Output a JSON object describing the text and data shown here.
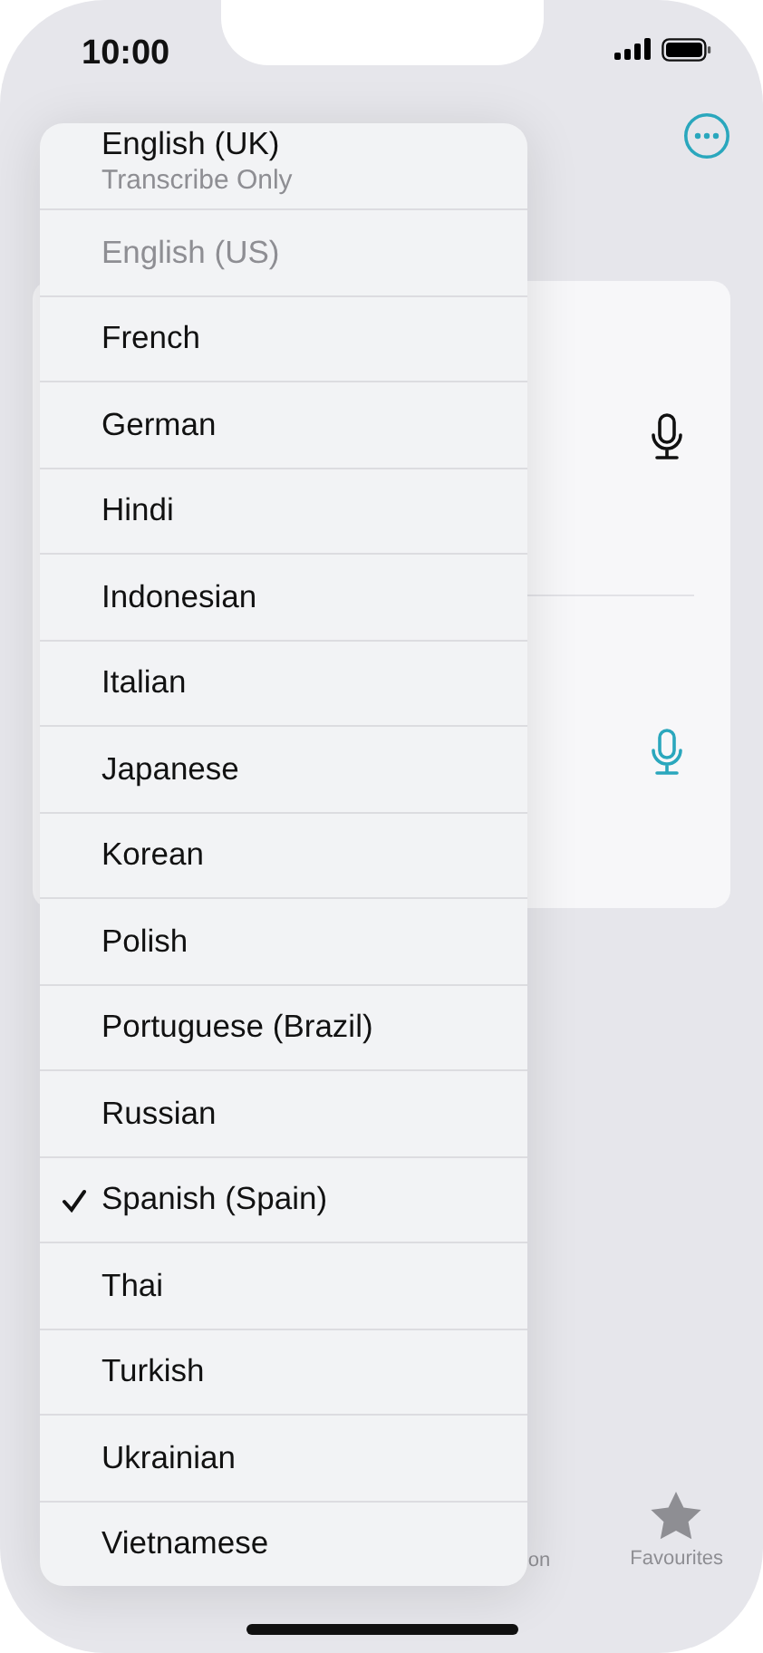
{
  "status_bar": {
    "time": "10:00"
  },
  "card": {
    "rows": [
      {
        "mic_active": false
      },
      {
        "mic_active": true
      }
    ]
  },
  "tab_bar": {
    "items": [
      {
        "label": "on",
        "kind": "text"
      },
      {
        "label": "Favourites",
        "kind": "star"
      }
    ]
  },
  "language_menu": {
    "items": [
      {
        "label": "English (UK)",
        "subtitle": "Transcribe Only",
        "disabled": false,
        "checked": false
      },
      {
        "label": "English (US)",
        "disabled": true,
        "checked": false
      },
      {
        "label": "French",
        "disabled": false,
        "checked": false
      },
      {
        "label": "German",
        "disabled": false,
        "checked": false
      },
      {
        "label": "Hindi",
        "disabled": false,
        "checked": false
      },
      {
        "label": "Indonesian",
        "disabled": false,
        "checked": false
      },
      {
        "label": "Italian",
        "disabled": false,
        "checked": false
      },
      {
        "label": "Japanese",
        "disabled": false,
        "checked": false
      },
      {
        "label": "Korean",
        "disabled": false,
        "checked": false
      },
      {
        "label": "Polish",
        "disabled": false,
        "checked": false
      },
      {
        "label": "Portuguese (Brazil)",
        "disabled": false,
        "checked": false
      },
      {
        "label": "Russian",
        "disabled": false,
        "checked": false
      },
      {
        "label": "Spanish (Spain)",
        "disabled": false,
        "checked": true
      },
      {
        "label": "Thai",
        "disabled": false,
        "checked": false
      },
      {
        "label": "Turkish",
        "disabled": false,
        "checked": false
      },
      {
        "label": "Ukrainian",
        "disabled": false,
        "checked": false
      },
      {
        "label": "Vietnamese",
        "disabled": false,
        "checked": false
      }
    ]
  }
}
